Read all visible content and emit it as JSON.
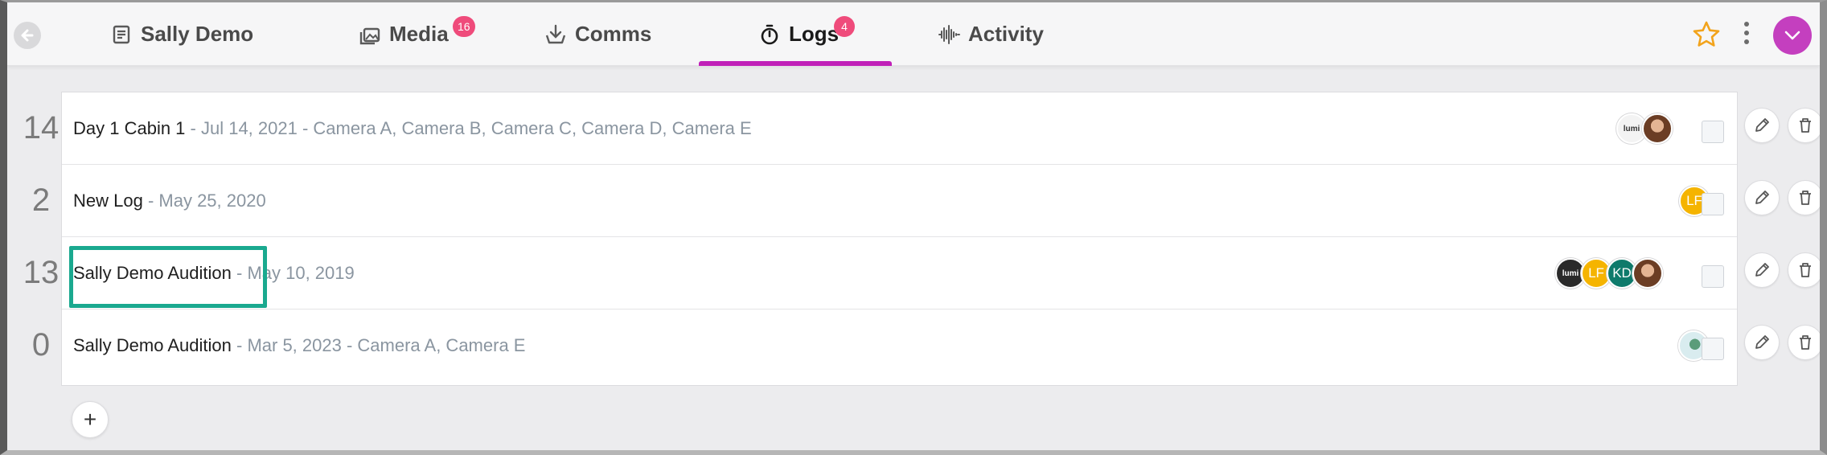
{
  "tabs": [
    {
      "label": "Sally Demo",
      "icon": "document-icon"
    },
    {
      "label": "Media",
      "icon": "media-icon",
      "badge": "16"
    },
    {
      "label": "Comms",
      "icon": "download-tray-icon"
    },
    {
      "label": "Logs",
      "icon": "stopwatch-icon",
      "badge": "4",
      "active": true
    },
    {
      "label": "Activity",
      "icon": "waveform-icon"
    }
  ],
  "colors": {
    "accent": "#c020b8",
    "badge": "#ef4b7b",
    "user_avatar": "#c43fbf",
    "highlight": "#1aa98f",
    "lf": "#f5b400",
    "kd": "#0e7a6b"
  },
  "logs": [
    {
      "count": "14",
      "name": "Day 1 Cabin 1",
      "meta": " - Jul 14, 2021 - Camera A, Camera B, Camera C, Camera D, Camera E"
    },
    {
      "count": "2",
      "name": "New Log",
      "meta": " - May 25, 2020",
      "avatar_lf": "LF"
    },
    {
      "count": "13",
      "name": "Sally Demo Audition",
      "meta": " - May 10, 2019",
      "avatar_lf": "LF",
      "avatar_kd": "KD"
    },
    {
      "count": "0",
      "name": "Sally Demo Audition",
      "meta": " - Mar 5, 2023 - Camera A, Camera E"
    }
  ],
  "add_label": "+"
}
